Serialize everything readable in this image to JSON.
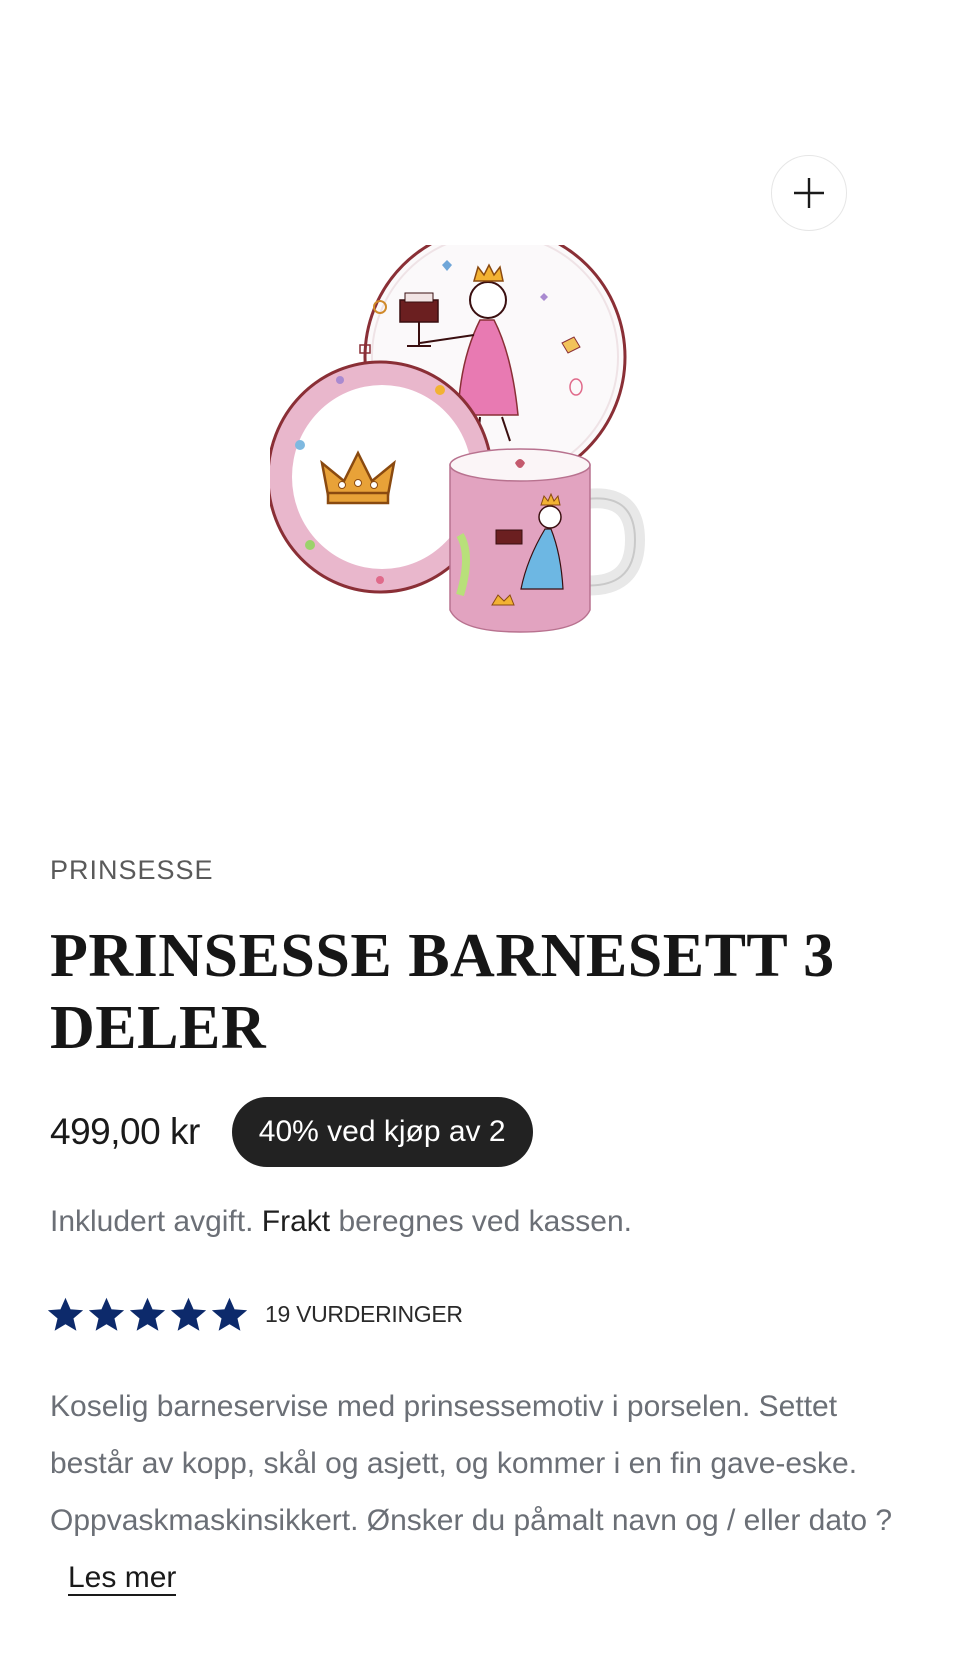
{
  "product": {
    "vendor": "PRINSESSE",
    "title": "PRINSESSE BARNESETT 3 DELER",
    "price": "499,00 kr",
    "badge": "40% ved kjøp av 2",
    "tax": {
      "prefix": "Inkludert avgift.",
      "link": "Frakt",
      "suffix": "beregnes ved kassen."
    },
    "rating": {
      "stars": 5,
      "max_stars": 5,
      "count_label": "19 VURDERINGER",
      "star_color": "#0d2a6b"
    },
    "description": "Koselig barneservise med prinsessemotiv i porselen. Settet består av kopp, skål og asjett, og kommer i en fin gave-eske. Oppvaskmaskinsikkert. Ønsker du påmalt navn og / eller dato ?",
    "read_more": "Les mer"
  },
  "media": {
    "zoom_icon": "plus-icon",
    "image": "child-dinner-set-princess"
  },
  "colors": {
    "badge_bg": "#222222",
    "muted_text": "#6b6f76"
  }
}
